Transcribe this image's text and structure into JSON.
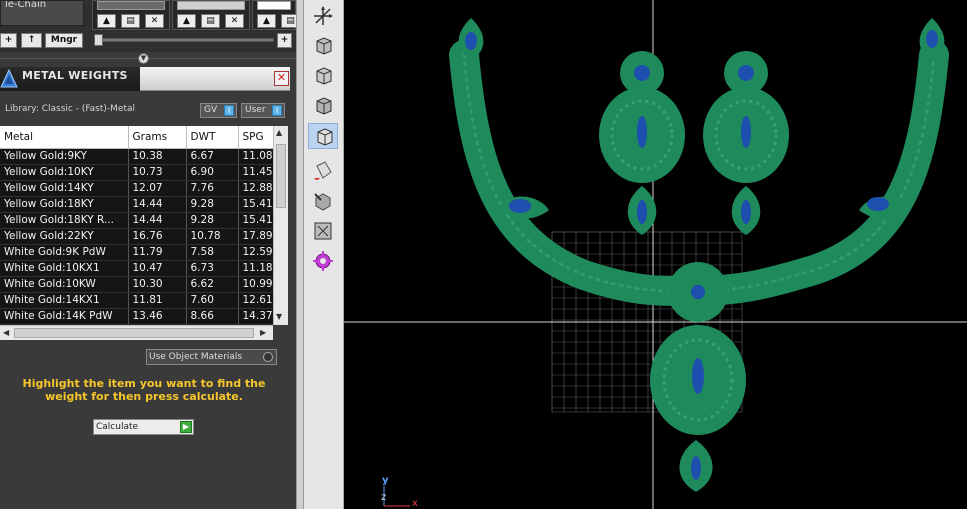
{
  "top": {
    "chain_label": "le-Chain",
    "mngr_label": "Mngr",
    "plus_label": "+",
    "up_label": "↑",
    "zoom_plus": "+"
  },
  "panel": {
    "title": "METAL WEIGHTS",
    "close_label": "✕",
    "library": "Library: Classic - (Fast)-Metal",
    "gv_label": "GV",
    "user_label": "User"
  },
  "table": {
    "headers": [
      "Metal",
      "Grams",
      "DWT",
      "SPG"
    ],
    "rows": [
      [
        "Yellow Gold:9KY",
        "10.38",
        "6.67",
        "11.08"
      ],
      [
        "Yellow Gold:10KY",
        "10.73",
        "6.90",
        "11.45"
      ],
      [
        "Yellow Gold:14KY",
        "12.07",
        "7.76",
        "12.88"
      ],
      [
        "Yellow Gold:18KY",
        "14.44",
        "9.28",
        "15.41"
      ],
      [
        "Yellow Gold:18KY R...",
        "14.44",
        "9.28",
        "15.41"
      ],
      [
        "Yellow Gold:22KY",
        "16.76",
        "10.78",
        "17.89"
      ],
      [
        "White Gold:9K PdW",
        "11.79",
        "7.58",
        "12.59"
      ],
      [
        "White Gold:10KX1",
        "10.47",
        "6.73",
        "11.18"
      ],
      [
        "White Gold:10KW",
        "10.30",
        "6.62",
        "10.99"
      ],
      [
        "White Gold:14KX1",
        "11.81",
        "7.60",
        "12.61"
      ],
      [
        "White Gold:14K PdW",
        "13.46",
        "8.66",
        "14.37"
      ]
    ]
  },
  "use_object_materials": "Use Object Materials",
  "hint": "Highlight the item you want to find the weight for then press calculate.",
  "calculate_label": "Calculate",
  "axes": {
    "y": "y",
    "z": "z",
    "x": "x"
  },
  "colors": {
    "gem_green": "#1f8a5c",
    "stone_blue": "#1c4fae",
    "hint_yellow": "#f6c62c"
  }
}
